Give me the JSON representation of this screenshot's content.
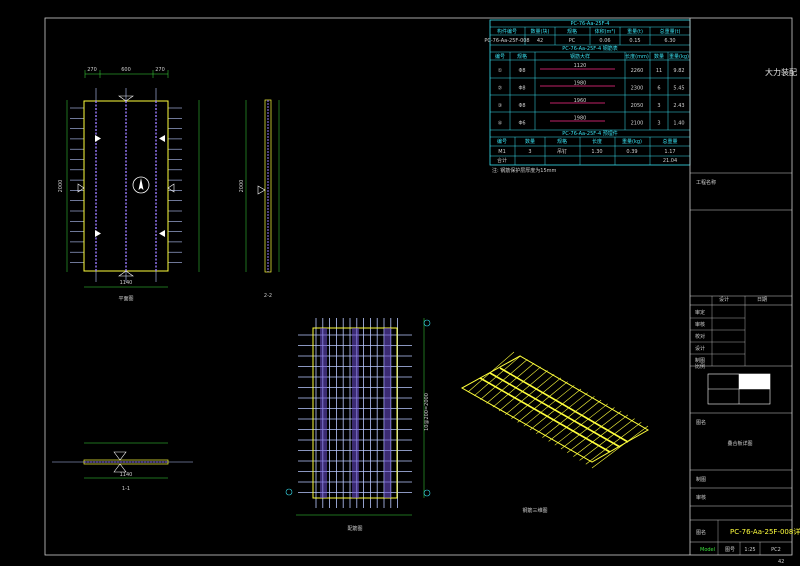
{
  "drawing": {
    "page_number": "42",
    "colors": {
      "background": "#000000",
      "rebar": "#b9c8ff",
      "panel_outline": "#ffff3c",
      "dimension": "#3ce03c",
      "table_line": "#38e0f0",
      "truss": "#9a7bff",
      "highlight": "#ff2e8c",
      "text": "#cfcfcf"
    }
  },
  "views": {
    "plan_label": "平面图",
    "section_22": "2-2",
    "section_11": "1-1",
    "rebar_label": "配筋图",
    "iso_label": "钢筋三维图",
    "plan_dims_top": [
      "270",
      "600",
      "270"
    ],
    "plan_width": "1140",
    "plan_height": "2000",
    "section22_height": "2000",
    "section11_width": "1140",
    "rebar_spacing": "10@200=2000"
  },
  "table": {
    "title1": "PC-76-Aa-25F-4",
    "hdr1": [
      "构件编号",
      "数量(块)",
      "规格",
      "体积(m³)",
      "重量(t)",
      "总重量(t)"
    ],
    "row1": [
      "PC-76-Aa-25F-008",
      "42",
      "PC",
      "0.06",
      "0.15",
      "6.30"
    ],
    "title2": "PC-76-Aa-25F-4 钢筋表",
    "hdr2": [
      "编号",
      "规格",
      "钢筋大样",
      "长度(mm)",
      "数量",
      "重量(kg)"
    ],
    "rows2": [
      [
        "①",
        "Φ8",
        "1120",
        "2260",
        "11",
        "9.82"
      ],
      [
        "②",
        "Φ8",
        "1980",
        "2300",
        "6",
        "5.45"
      ],
      [
        "③",
        "Φ8",
        "1960",
        "2050",
        "3",
        "2.43"
      ],
      [
        "④",
        "Φ6",
        "1980",
        "2100",
        "3",
        "1.40"
      ]
    ],
    "title3": "PC-76-Aa-25F-4 预埋件",
    "hdr3": [
      "编号",
      "数量",
      "规格",
      "长度",
      "重量(kg)",
      "总重量"
    ],
    "rows3": [
      [
        "M1",
        "3",
        "吊钉",
        "1.30",
        "0.39",
        "1.17"
      ],
      [
        "合计",
        "",
        "",
        "",
        "",
        "21.04"
      ]
    ],
    "footnote": "注: 钢筋保护层厚度为15mm"
  },
  "title_block": {
    "company": "大力装配",
    "project_label": "工程名称",
    "rows": [
      "审定",
      "审核",
      "校对",
      "设计",
      "制图",
      "比例"
    ],
    "designer": "设计",
    "date": "日期",
    "sheet_name": "叠合板详图",
    "drawn": "制图",
    "checked": "审核",
    "drawing_name_label": "图名",
    "drawing_code": "PC-76-Aa-25F-008详图",
    "scale": "1:25",
    "status": "Model",
    "sheet_no_label": "图号",
    "sheet_no": "PC2"
  }
}
